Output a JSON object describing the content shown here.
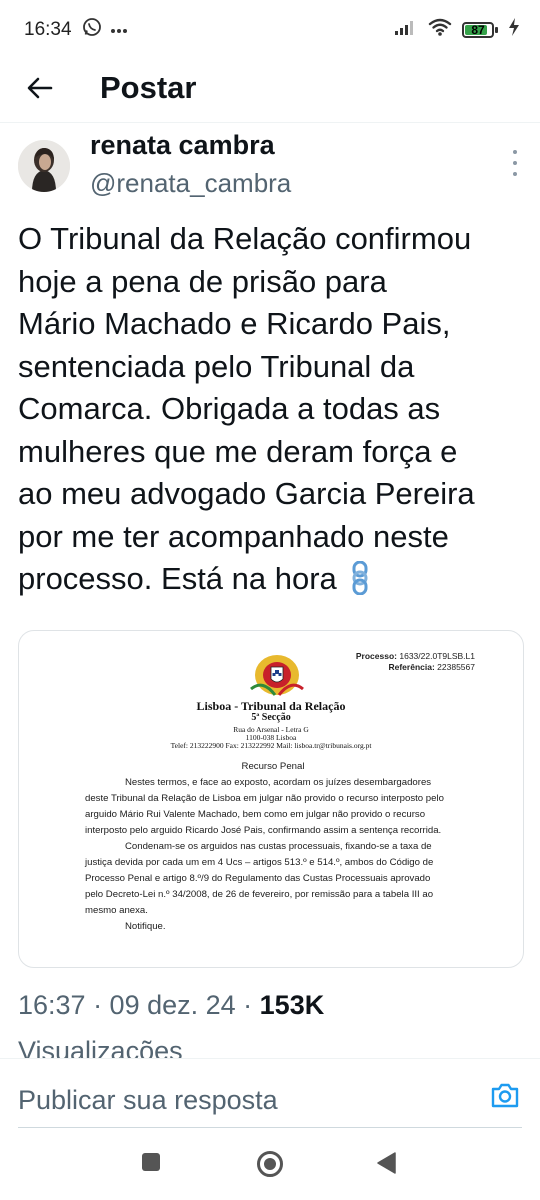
{
  "status_bar": {
    "time": "16:34",
    "notification_icons": [
      "whatsapp-icon",
      "more-dots-icon"
    ],
    "battery_level": "87",
    "battery_fraction": 0.87
  },
  "header": {
    "title": "Postar",
    "back_icon": "arrow-left-icon"
  },
  "author": {
    "name": "renata cambra",
    "handle": "@renata_cambra"
  },
  "tweet": {
    "lines": [
      "O Tribunal da Relação confirmou",
      "hoje a pena de prisão para",
      "Mário Machado e Ricardo Pais,",
      "sentenciada pelo Tribunal da",
      "Comarca. Obrigada a todas as",
      "mulheres que me deram força e",
      "ao meu advogado Garcia Pereira",
      "por me ter acompanhado neste",
      "processo. Está na hora"
    ],
    "emoji": "chains-icon"
  },
  "document": {
    "processo_label": "Processo:",
    "processo_value": "1633/22.0T9LSB.L1",
    "referencia_label": "Referência:",
    "referencia_value": "22385567",
    "court_title": "Lisboa - Tribunal da Relação",
    "section": "5ª Secção",
    "address1": "Rua do Arsenal - Letra G",
    "address2": "1100-038 Lisboa",
    "contacts": "Telef: 213222900 Fax: 213222992 Mail: lisboa.tr@tribunais.org.pt",
    "heading": "Recurso Penal",
    "body_lines": [
      "Nestes termos, e face ao exposto, acordam os juízes desembargadores",
      "deste Tribunal da Relação de Lisboa em julgar não provido o recurso interposto pelo",
      "arguido Mário Rui Valente Machado, bem como em julgar não provido o recurso",
      "interposto pelo arguido Ricardo José Pais, confirmando assim a sentença recorrida.",
      "Condenam-se os arguidos nas custas processuais, fixando-se a taxa de",
      "justiça devida por cada um em 4 Ucs – artigos 513.º e 514.º, ambos do Código de",
      "Processo Penal e artigo 8.º/9 do Regulamento das Custas Processuais aprovado",
      "pelo Decreto-Lei n.º 34/2008, de 26 de fevereiro, por remissão para a tabela III ao",
      "mesmo anexa.",
      "Notifique."
    ]
  },
  "meta": {
    "time_date": "16:37 · 09 dez. 24 · ",
    "views_count": "153K",
    "views_label": "Visualizações"
  },
  "reply": {
    "placeholder": "Publicar sua resposta",
    "camera_icon": "camera-icon"
  },
  "nav": {
    "buttons": [
      "recents-square-icon",
      "home-circle-icon",
      "back-triangle-icon"
    ]
  },
  "colors": {
    "text_primary": "#0f1419",
    "text_secondary": "#536471",
    "accent_blue": "#1d9bf0",
    "chain_blue": "#5b9bd5",
    "battery_green": "#35a24a"
  }
}
